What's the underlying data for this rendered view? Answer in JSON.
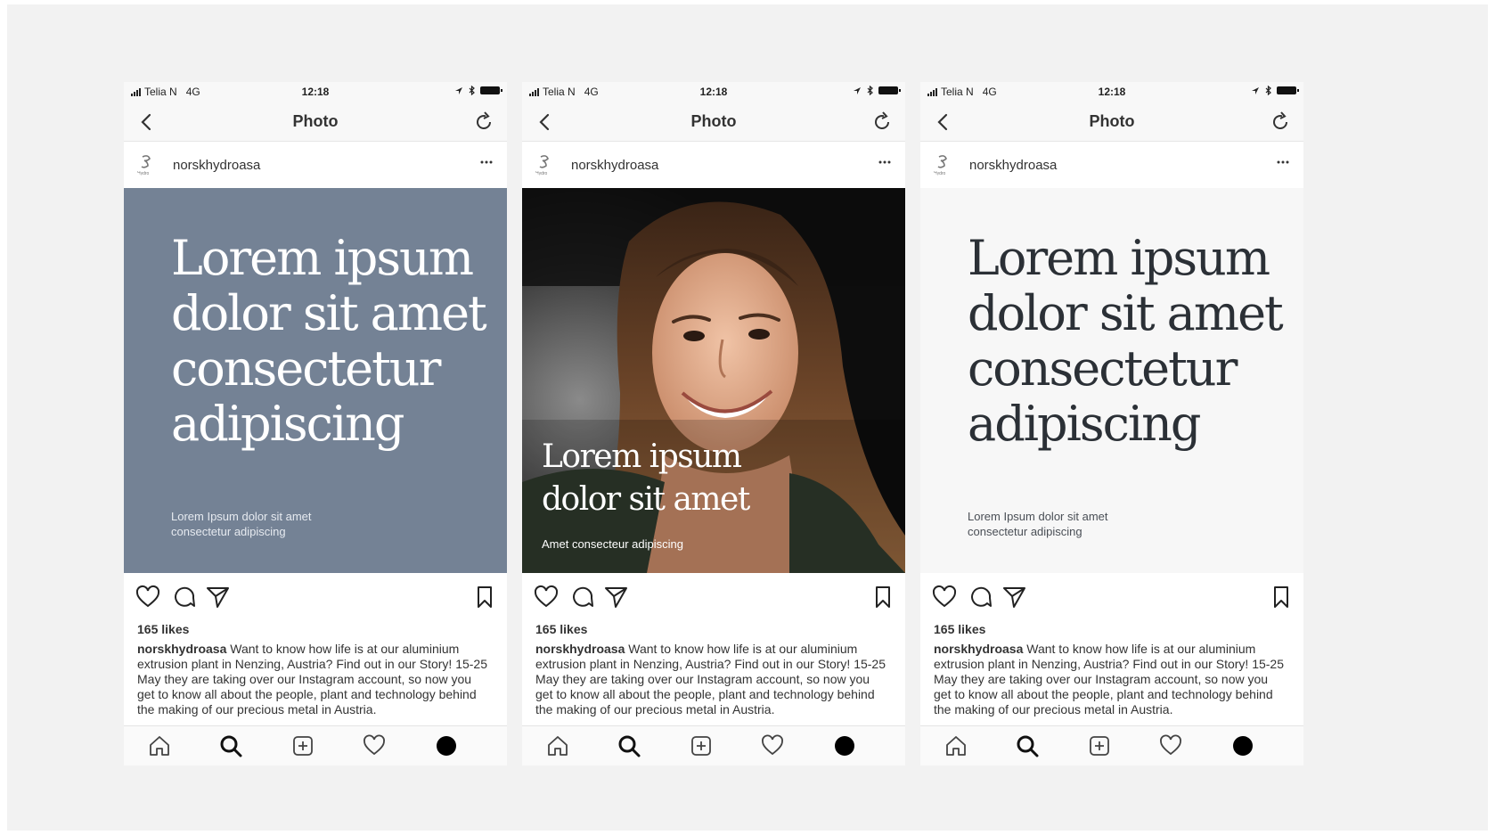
{
  "status_bar": {
    "carrier": "Telia N",
    "network": "4G",
    "time": "12:18"
  },
  "nav": {
    "title": "Photo"
  },
  "post": {
    "username": "norskhydroasa",
    "avatar_label": "Hydro",
    "likes": "165 likes",
    "caption_user": "norskhydroasa",
    "caption_text": " Want to know how life is at our aluminium extrusion plant in Nenzing, Austria? Find out in our Story! 15-25 May they are taking over our Instagram account, so now you get to know all about the people, plant and technology behind the making of our precious metal in Austria. #instagramtakeover #norskhydro"
  },
  "variants": [
    {
      "style": "blue",
      "headline": "Lorem ipsum dolor sit amet consectetur adipiscing",
      "subline": "Lorem Ipsum dolor sit amet consectetur adipiscing"
    },
    {
      "style": "photo",
      "headline": "Lorem ipsum dolor sit amet",
      "subline": "Amet consecteur adipiscing"
    },
    {
      "style": "white",
      "headline": "Lorem ipsum dolor sit amet consectetur adipiscing",
      "subline": "Lorem Ipsum dolor sit amet consectetur adipiscing"
    }
  ],
  "colors": {
    "blue_panel": "#748295",
    "white_panel": "#f7f7f7",
    "background": "#f2f2f2"
  },
  "icons": [
    "back-icon",
    "refresh-icon",
    "more-icon",
    "heart-icon",
    "comment-icon",
    "share-icon",
    "bookmark-icon",
    "home-icon",
    "search-icon",
    "add-icon",
    "activity-icon",
    "profile-icon"
  ]
}
